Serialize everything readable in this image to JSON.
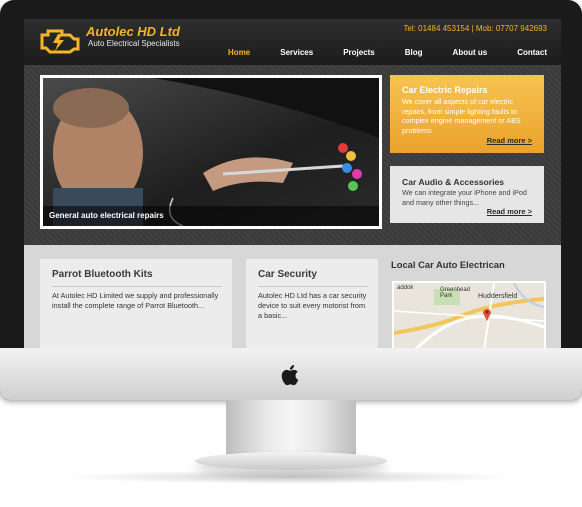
{
  "site": {
    "brand": "Autolec HD Ltd",
    "tagline": "Auto Electrical Specialists",
    "contact": "Tel: 01484 453154 | Mob: 07707 942693",
    "nav": [
      "Home",
      "Services",
      "Projects",
      "Blog",
      "About us",
      "Contact"
    ],
    "active_nav": "Home"
  },
  "hero": {
    "caption": "General auto electrical repairs"
  },
  "promos": [
    {
      "title": "Car Electric Repairs",
      "text": "We cover all aspects of car electric repairs, from simple lighting faults to complex engine management or ABS problems",
      "more": "Read more >"
    },
    {
      "title": "Car Audio & Accessories",
      "text": "We can integrate your iPhone and iPod and many other things...",
      "more": "Read more >"
    }
  ],
  "cards": [
    {
      "title": "Parrot Bluetooth Kits",
      "text": "At Autolec HD Limited we supply and professionally install the complete range of Parrot Bluetooth..."
    },
    {
      "title": "Car Security",
      "text": "Autolec HD Ltd has a car security device to suit every motorist from a basic..."
    }
  ],
  "map": {
    "title": "Local Car Auto Electrican",
    "labels": [
      "Huddersfield",
      "Greenhead Park",
      "addok"
    ]
  },
  "colors": {
    "accent": "#f5b526",
    "header_bg": "#1c1c1c",
    "content_bg": "#d7d7d7"
  },
  "icons": [
    "engine-warning-icon",
    "apple-logo-icon",
    "map-pin-icon"
  ]
}
